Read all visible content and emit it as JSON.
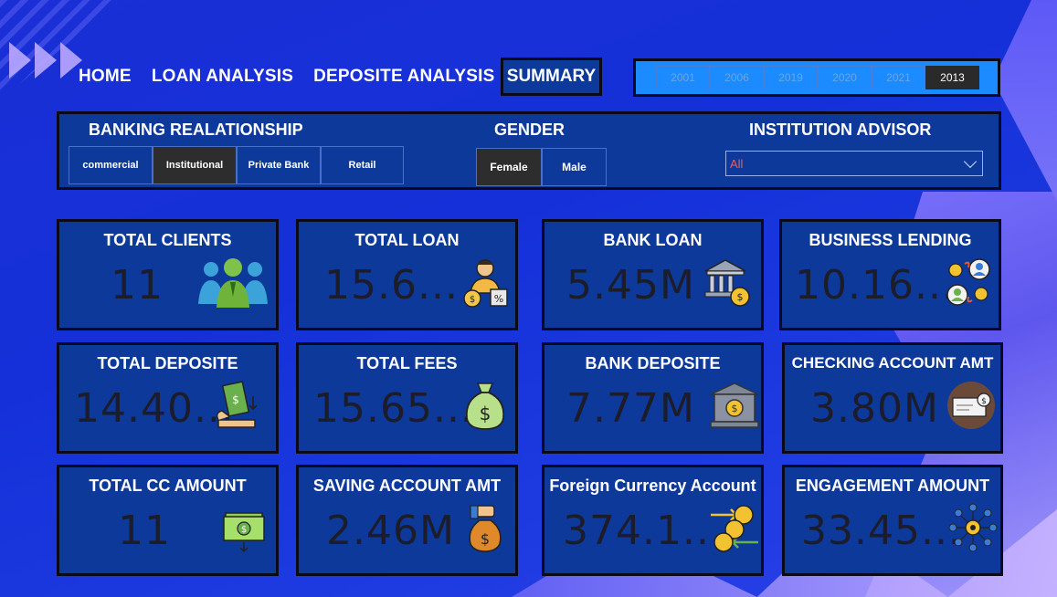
{
  "nav": {
    "home": "HOME",
    "loan_analysis": "LOAN ANALYSIS",
    "deposite_analysis": "DEPOSITE ANALYSIS",
    "summary": "SUMMARY"
  },
  "years": [
    "2001",
    "2006",
    "2019",
    "2020",
    "2021",
    "2013"
  ],
  "selected_year": "2013",
  "filters": {
    "banking_title": "BANKING REALATIONSHIP",
    "banking_options": [
      "commercial",
      "Institutional",
      "Private Bank",
      "Retail"
    ],
    "banking_selected": "Institutional",
    "gender_title": "GENDER",
    "gender_options": [
      "Female",
      "Male"
    ],
    "gender_selected": "Female",
    "advisor_title": "INSTITUTION ADVISOR",
    "advisor_value": "All"
  },
  "cards": {
    "total_clients": {
      "title": "TOTAL CLIENTS",
      "value": "11",
      "icon": "people-group-icon"
    },
    "total_loan": {
      "title": "TOTAL LOAN",
      "value": "15.6...",
      "icon": "loan-person-icon"
    },
    "bank_loan": {
      "title": "BANK LOAN",
      "value": "5.45M",
      "icon": "bank-coin-icon"
    },
    "business_lending": {
      "title": "BUSINESS LENDING",
      "value": "10.16...",
      "icon": "exchange-people-icon"
    },
    "total_deposite": {
      "title": "TOTAL DEPOSITE",
      "value": "14.40...",
      "icon": "hand-deposit-icon"
    },
    "total_fees": {
      "title": "TOTAL FEES",
      "value": "15.65...",
      "icon": "money-bag-icon"
    },
    "bank_deposite": {
      "title": "BANK DEPOSITE",
      "value": "7.77M",
      "icon": "bank-building-icon"
    },
    "checking_account": {
      "title": "CHECKING ACCOUNT AMT",
      "value": "3.80M",
      "icon": "cheque-icon"
    },
    "total_cc": {
      "title": "TOTAL CC AMOUNT",
      "value": "11",
      "icon": "cash-stack-icon"
    },
    "saving_account": {
      "title": "SAVING ACCOUNT AMT",
      "value": "2.46M",
      "icon": "hand-bag-icon"
    },
    "foreign_currency": {
      "title": "Foreign Currency Account",
      "value": "374.1...",
      "icon": "currency-exchange-icon"
    },
    "engagement": {
      "title": "ENGAGEMENT AMOUNT",
      "value": "33.45...",
      "icon": "network-gear-icon"
    }
  },
  "colors": {
    "background": "#1a2fd6",
    "panel": "#0d3a9a",
    "border": "#0a0a1a",
    "selected": "#2d2d2d",
    "year_bar": "#1b8bff",
    "value_text": "#1c1c2a"
  }
}
